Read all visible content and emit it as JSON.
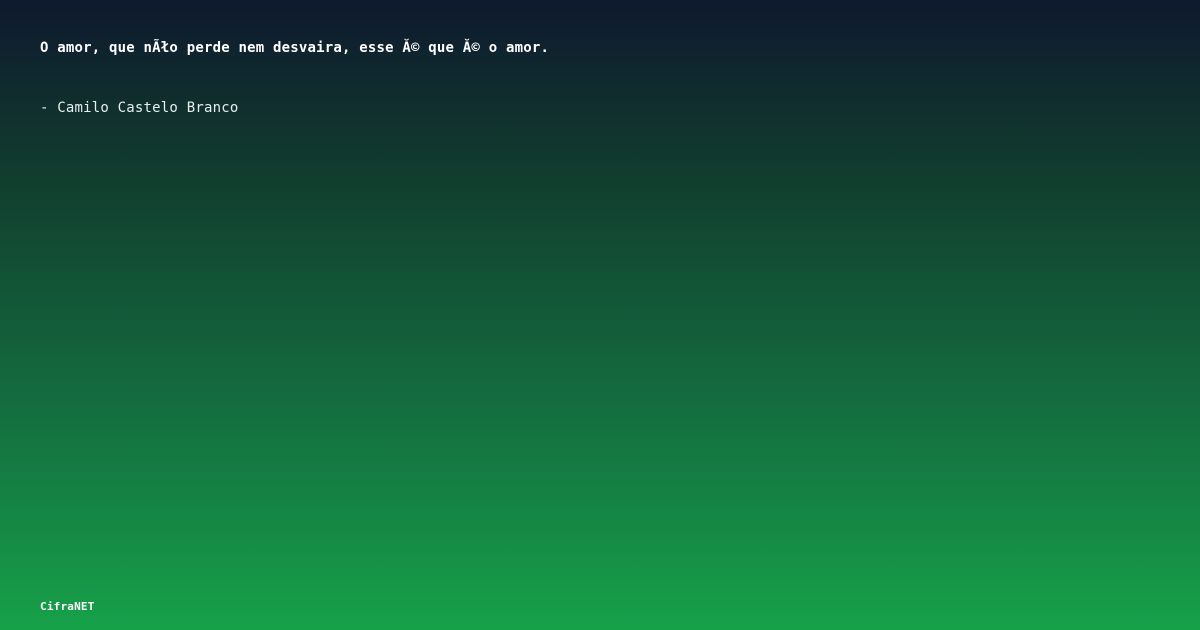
{
  "quote": {
    "text": "O amor, que nÃło perde nem desvaira, esse Ă© que Ă© o amor.",
    "author": "- Camilo Castelo Branco"
  },
  "footer": {
    "brand": "CifraNET"
  },
  "colors": {
    "gradient_top": "#0e192d",
    "gradient_bottom": "#16a149",
    "text": "#ffffff"
  }
}
